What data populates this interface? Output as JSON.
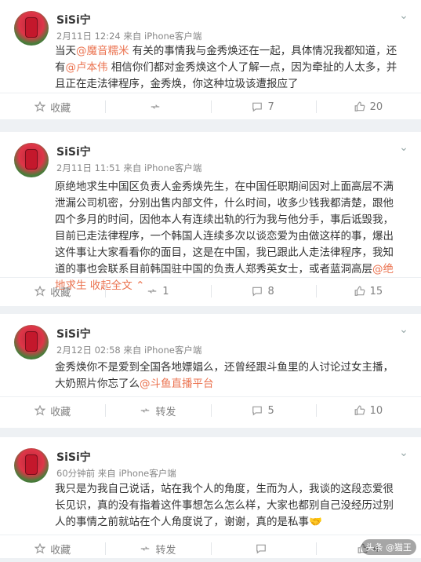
{
  "posts": [
    {
      "username": "SiSi宁",
      "meta": "2月11日 12:24 来自 iPhone客户端",
      "text_before": "当天",
      "mention1": "@魔音糯米",
      "text_mid1": " 有关的事情我与金秀焕还在一起，具体情况我都知道，还有",
      "mention2": "@卢本伟",
      "text_after": " 相信你们都对金秀焕这个人了解一点，因为牵扯的人太多，并且正在走法律程序，金秀焕，你这种垃圾该遭报应了",
      "actions": {
        "collect": "收藏",
        "repost": "",
        "comments": "7",
        "likes": "20"
      }
    },
    {
      "username": "SiSi宁",
      "meta": "2月11日 11:51 来自 iPhone客户端",
      "text": "原绝地求生中国区负责人金秀焕先生，在中国任职期间因对上面高层不满泄漏公司机密，分别出售内部文件，什么时间，收多少钱我都清楚，跟他四个多月的时间，因他本人有连续出轨的行为我与他分手，事后诋毁我，目前已走法律程序，一个韩国人连续多次以谈恋爱为由做这样的事，爆出这件事让大家看看你的面目，这是在中国，我已跟此人走法律程序，我知道的事也会联系目前韩国驻中国的负责人郑秀英女士，或者蓝洞高层",
      "mention": "@绝地求生",
      "expand": " 收起全文 ",
      "actions": {
        "collect": "收藏",
        "repost": "1",
        "comments": "8",
        "likes": "15"
      }
    },
    {
      "username": "SiSi宁",
      "meta": "2月12日 02:58 来自 iPhone客户端",
      "text": "金秀焕你不是爱到全国各地嫖娼么，还曾经跟斗鱼里的人讨论过女主播，大奶照片你忘了么",
      "mention": "@斗鱼直播平台",
      "actions": {
        "collect": "收藏",
        "repost": "转发",
        "comments": "5",
        "likes": "10"
      }
    },
    {
      "username": "SiSi宁",
      "meta": "60分钟前 来自 iPhone客户端",
      "text": "我只是为我自己说话，站在我个人的角度，生而为人，我谈的这段恋爱很长见识，真的没有指着这件事想怎么怎么样，大家也都别自己没经历过别人的事情之前就站在个人角度说了，谢谢，真的是私事",
      "emoji": "🤝",
      "actions": {
        "collect": "收藏",
        "repost": "转发",
        "comments": "",
        "likes": "4"
      }
    }
  ],
  "footer_badge": "头条 @猫王 "
}
